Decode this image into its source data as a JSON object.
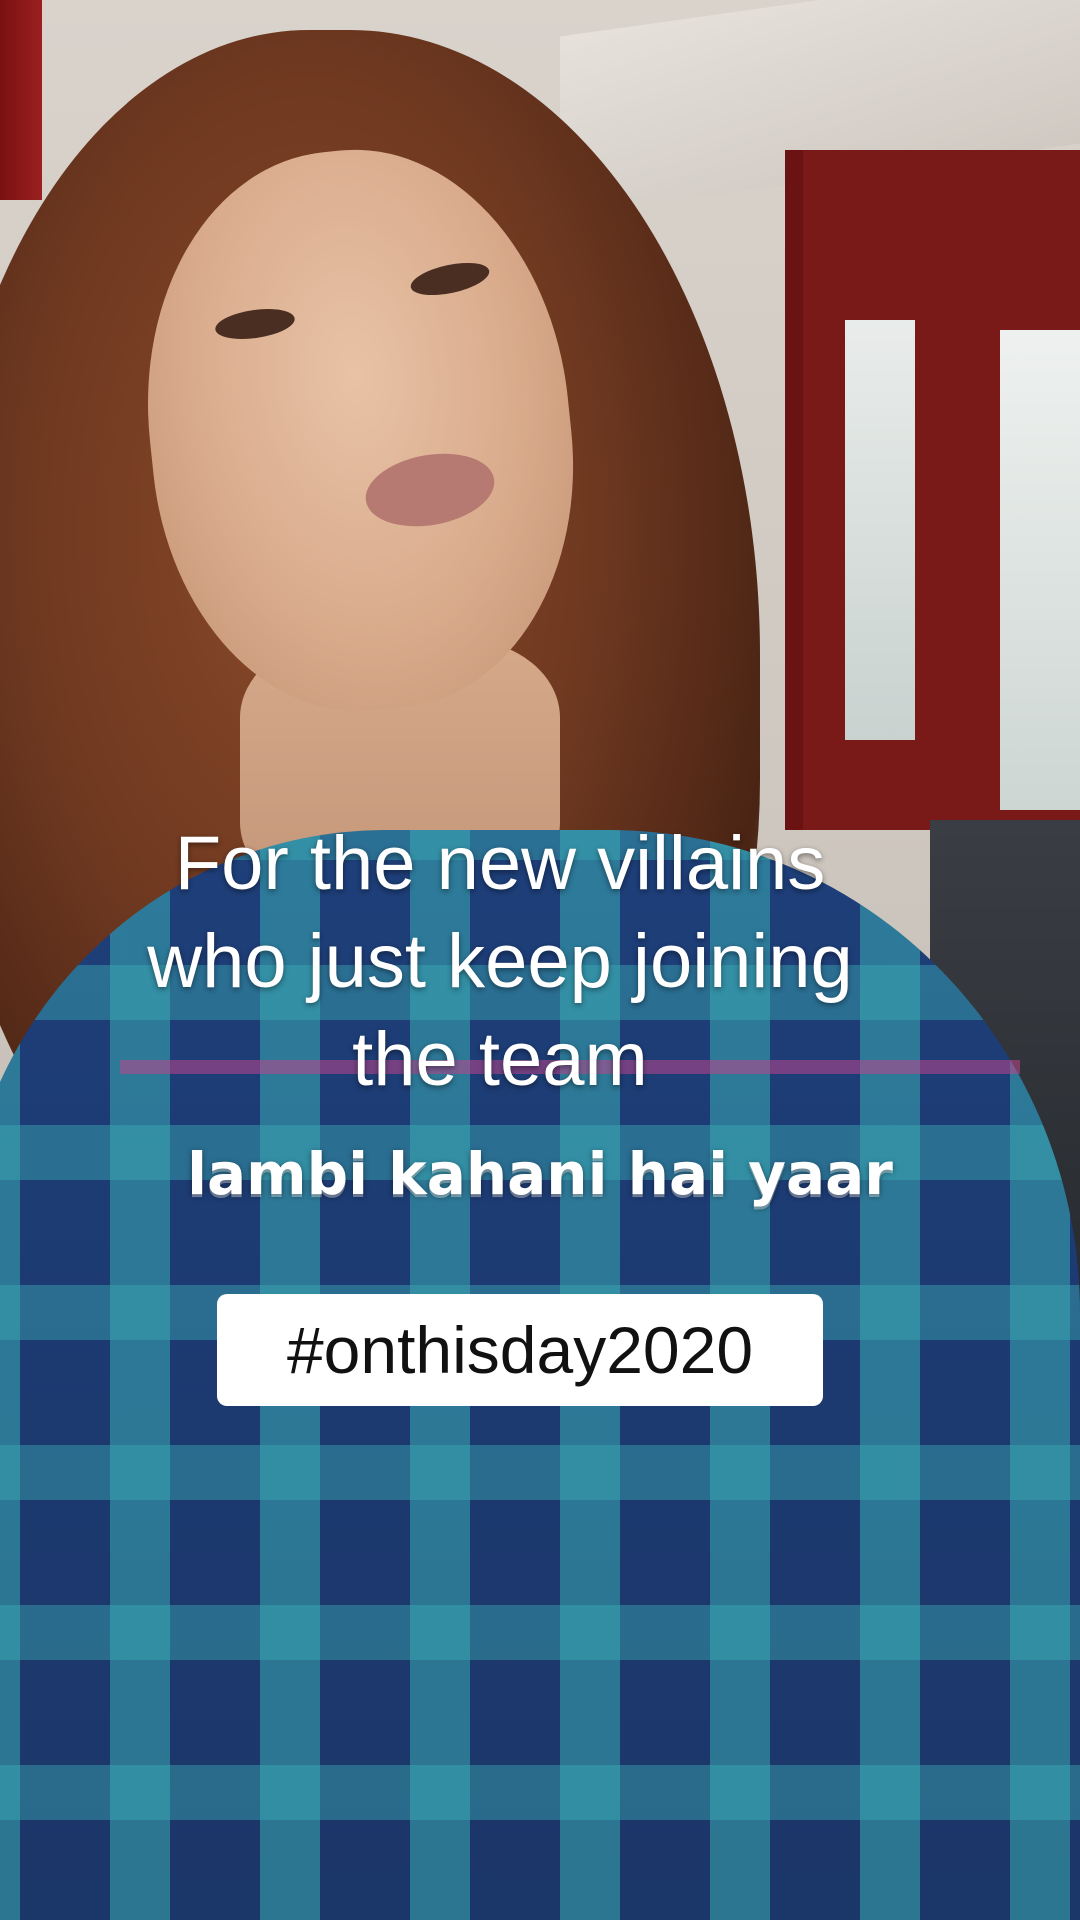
{
  "overlay": {
    "caption_lines": [
      "For the new villains",
      "who just keep joining",
      "the team"
    ],
    "subtitle": "lambi kahani hai yaar",
    "hashtag": "#onthisday2020"
  },
  "colors": {
    "caption_text": "#ffffff",
    "hashtag_box": "#ffffff",
    "hashtag_text": "#111111",
    "door_red": "#7a1a18",
    "shirt_blue": "#1e3f7a",
    "shirt_teal": "#3aaab4"
  }
}
